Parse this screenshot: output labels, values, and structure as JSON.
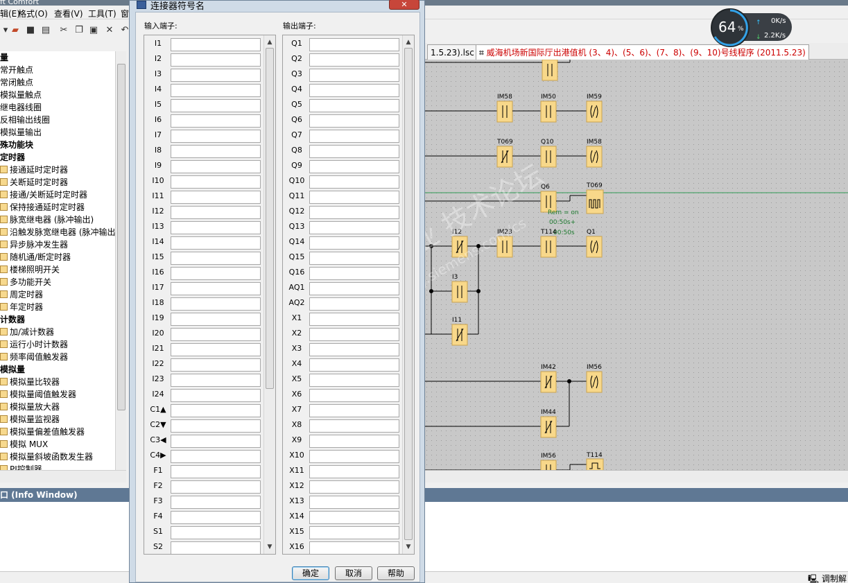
{
  "app": {
    "title": "ft Comfort",
    "menu": [
      "辑(E)",
      "格式(O)",
      "查看(V)",
      "工具(T)",
      "窗"
    ]
  },
  "left_tree": {
    "items": [
      {
        "label": "量",
        "bold": true,
        "icon": false
      },
      {
        "label": "常开触点",
        "bold": false,
        "icon": false
      },
      {
        "label": "常闭触点",
        "bold": false,
        "icon": false
      },
      {
        "label": "模拟量触点",
        "bold": false,
        "icon": false
      },
      {
        "label": "继电器线圈",
        "bold": false,
        "icon": false
      },
      {
        "label": "反相输出线圈",
        "bold": false,
        "icon": false
      },
      {
        "label": "模拟量输出",
        "bold": false,
        "icon": false
      },
      {
        "label": "殊功能块",
        "bold": true,
        "icon": false
      },
      {
        "label": "定时器",
        "bold": true,
        "icon": false
      },
      {
        "label": "接通延时定时器",
        "bold": false,
        "icon": true
      },
      {
        "label": "关断延时定时器",
        "bold": false,
        "icon": true
      },
      {
        "label": "接通/关断延时定时器",
        "bold": false,
        "icon": true
      },
      {
        "label": "保持接通延时定时器",
        "bold": false,
        "icon": true
      },
      {
        "label": "脉宽继电器 (脉冲输出)",
        "bold": false,
        "icon": true
      },
      {
        "label": "沿触发脉宽继电器 (脉冲输出",
        "bold": false,
        "icon": true
      },
      {
        "label": "异步脉冲发生器",
        "bold": false,
        "icon": true
      },
      {
        "label": "随机通/断定时器",
        "bold": false,
        "icon": true
      },
      {
        "label": "楼梯照明开关",
        "bold": false,
        "icon": true
      },
      {
        "label": "多功能开关",
        "bold": false,
        "icon": true
      },
      {
        "label": "周定时器",
        "bold": false,
        "icon": true
      },
      {
        "label": "年定时器",
        "bold": false,
        "icon": true
      },
      {
        "label": "计数器",
        "bold": true,
        "icon": false
      },
      {
        "label": "加/减计数器",
        "bold": false,
        "icon": true
      },
      {
        "label": "运行小时计数器",
        "bold": false,
        "icon": true
      },
      {
        "label": "频率阈值触发器",
        "bold": false,
        "icon": true
      },
      {
        "label": "模拟量",
        "bold": true,
        "icon": false
      },
      {
        "label": "模拟量比较器",
        "bold": false,
        "icon": true
      },
      {
        "label": "模拟量阈值触发器",
        "bold": false,
        "icon": true
      },
      {
        "label": "模拟量放大器",
        "bold": false,
        "icon": true
      },
      {
        "label": "模拟量监视器",
        "bold": false,
        "icon": true
      },
      {
        "label": "模拟量偏差值触发器",
        "bold": false,
        "icon": true
      },
      {
        "label": "模拟 MUX",
        "bold": false,
        "icon": true
      },
      {
        "label": "模拟量斜坡函数发生器",
        "bold": false,
        "icon": true
      },
      {
        "label": "PI控制器",
        "bold": false,
        "icon": true
      }
    ]
  },
  "info_window": {
    "title": "口 (Info Window)"
  },
  "statusbar": {
    "right_text": "调制解"
  },
  "network_gauge": {
    "percent": "64",
    "percent_sign": "%",
    "up": "0K/s",
    "down": "2.2K/s"
  },
  "tabs": [
    {
      "label": "1.5.23).lsc",
      "active": false
    },
    {
      "label": "威海机场新国际厅出港值机 (3、4)、(5、6)、(7、8)、(9、10)号线程序 (2011.5.23)",
      "active": true
    }
  ],
  "canvas": {
    "block_labels": [
      "IM58",
      "IM50",
      "IM59",
      "T069",
      "Q10",
      "IM58",
      "Q6",
      "T069",
      "I12",
      "IM23",
      "T114",
      "Q1",
      "I3",
      "I11",
      "IM42",
      "IM56",
      "IM44",
      "IM56",
      "T114"
    ],
    "timer_annot": [
      "Rem = on",
      "00:50s+",
      "00:50s"
    ]
  },
  "watermark": {
    "line1": "西门子工业 技术论坛",
    "line2": "support.industry.siemens.com/cs"
  },
  "dialog": {
    "title": "连接器符号名",
    "input_label": "输入端子:",
    "output_label": "输出端子:",
    "inputs": [
      "I1",
      "I2",
      "I3",
      "I4",
      "I5",
      "I6",
      "I7",
      "I8",
      "I9",
      "I10",
      "I11",
      "I12",
      "I13",
      "I14",
      "I15",
      "I16",
      "I17",
      "I18",
      "I19",
      "I20",
      "I21",
      "I22",
      "I23",
      "I24",
      "C1▲",
      "C2▼",
      "C3◀",
      "C4▶",
      "F1",
      "F2",
      "F3",
      "F4",
      "S1",
      "S2"
    ],
    "outputs": [
      "Q1",
      "Q2",
      "Q3",
      "Q4",
      "Q5",
      "Q6",
      "Q7",
      "Q8",
      "Q9",
      "Q10",
      "Q11",
      "Q12",
      "Q13",
      "Q14",
      "Q15",
      "Q16",
      "AQ1",
      "AQ2",
      "X1",
      "X2",
      "X3",
      "X4",
      "X5",
      "X6",
      "X7",
      "X8",
      "X9",
      "X10",
      "X11",
      "X12",
      "X13",
      "X14",
      "X15",
      "X16"
    ],
    "buttons": {
      "ok": "确定",
      "cancel": "取消",
      "help": "帮助"
    }
  }
}
